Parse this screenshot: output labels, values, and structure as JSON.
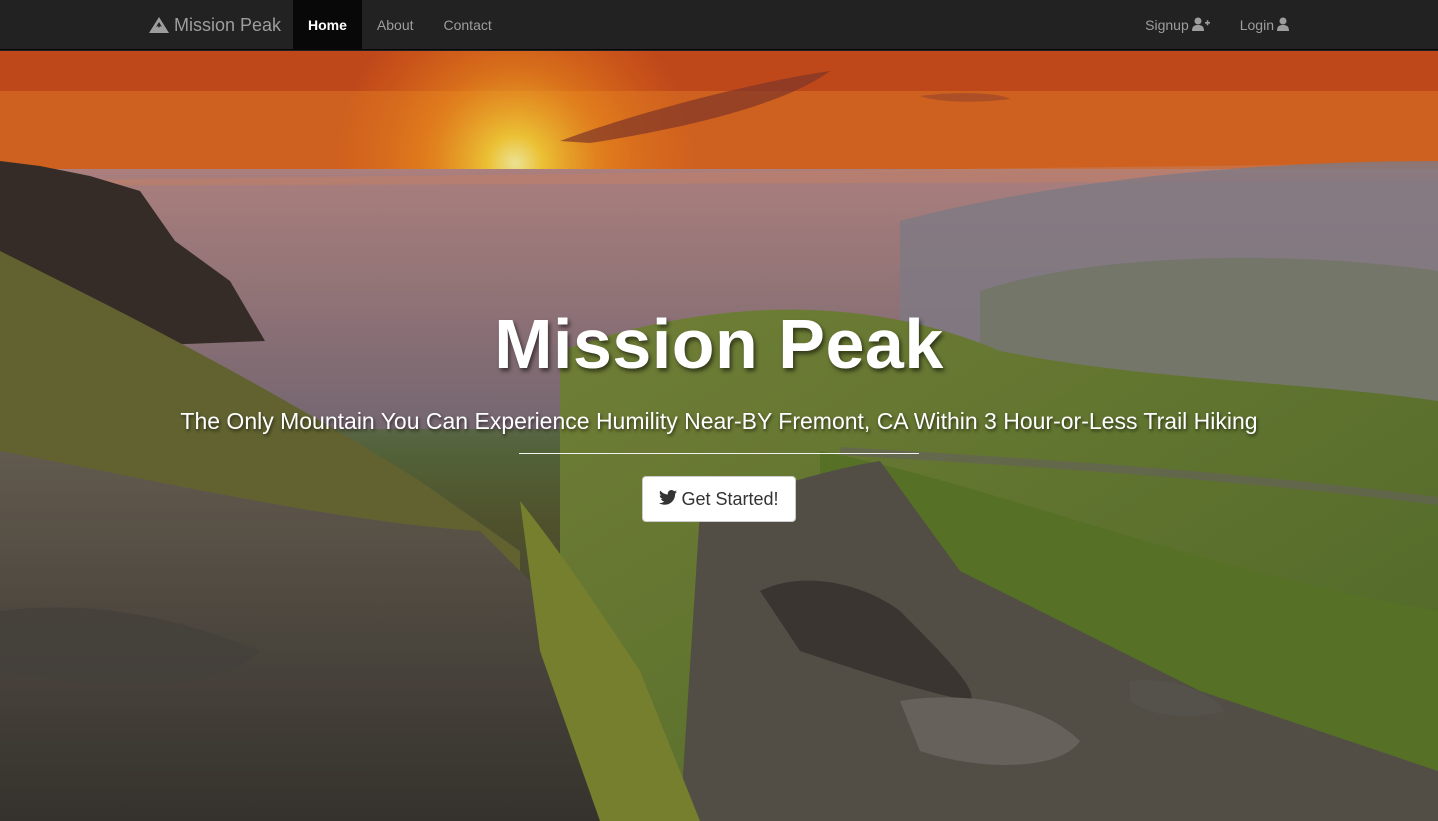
{
  "navbar": {
    "brand": "Mission Peak",
    "brand_icon": "mountain-icon",
    "left_items": [
      {
        "label": "Home",
        "active": true
      },
      {
        "label": "About",
        "active": false
      },
      {
        "label": "Contact",
        "active": false
      }
    ],
    "right_items": [
      {
        "label": "Signup",
        "icon": "user-plus-icon"
      },
      {
        "label": "Login",
        "icon": "user-icon"
      }
    ]
  },
  "hero": {
    "title": "Mission Peak",
    "subtitle": "The Only Mountain You Can Experience Humility Near-BY Fremont, CA Within 3 Hour-or-Less Trail Hiking",
    "cta_label": "Get Started!",
    "cta_icon": "twitter-bird-icon"
  },
  "colors": {
    "navbar_bg": "#222222",
    "nav_text": "#9d9d9d",
    "nav_active_bg": "#080808"
  }
}
